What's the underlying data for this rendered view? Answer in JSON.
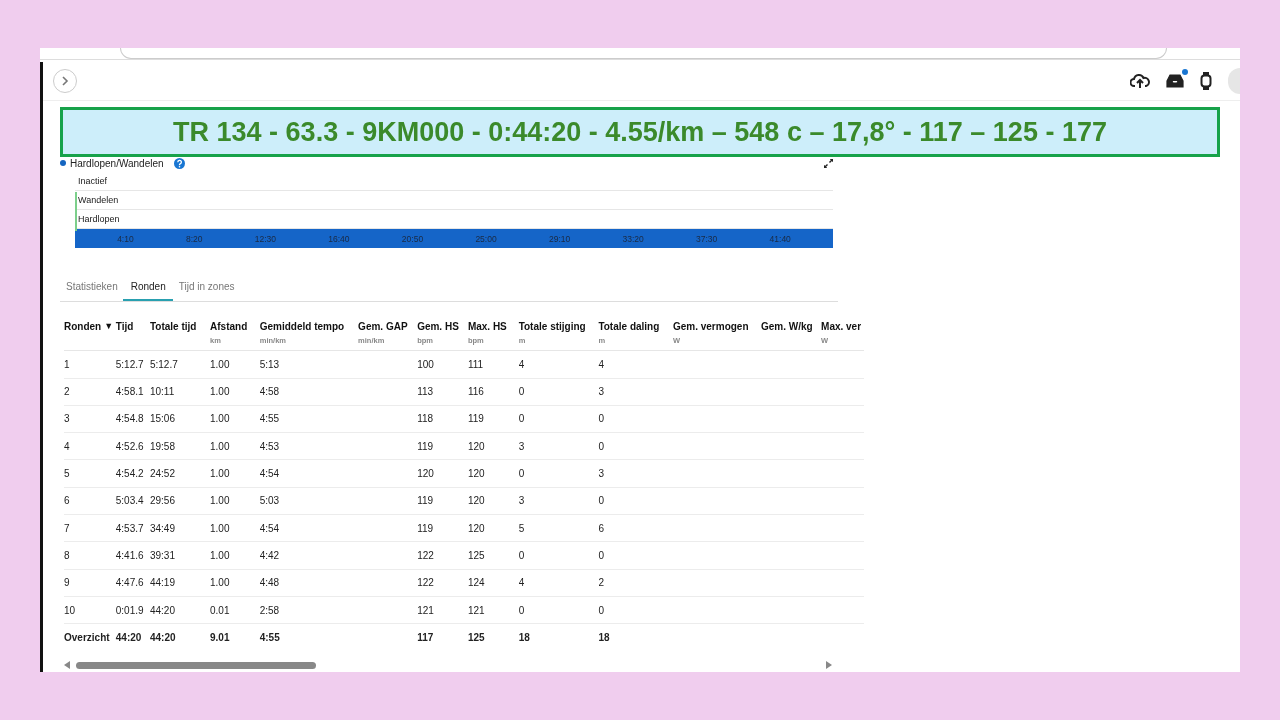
{
  "header": {
    "has_notification": true
  },
  "banner": {
    "text": "TR 134 - 63.3 - 9KM000 - 0:44:20 - 4.55/km – 548 c – 17,8° - 117 – 125 - 177"
  },
  "activity_chart": {
    "legend": "Hardlopen/Wandelen",
    "lanes": [
      "Inactief",
      "Wandelen",
      "Hardlopen"
    ],
    "ticks": [
      "4:10",
      "8:20",
      "12:30",
      "16:40",
      "20:50",
      "25:00",
      "29:10",
      "33:20",
      "37:30",
      "41:40"
    ]
  },
  "tabs": [
    {
      "label": "Statistieken",
      "selected": false
    },
    {
      "label": "Ronden",
      "selected": true
    },
    {
      "label": "Tijd in zones",
      "selected": false
    }
  ],
  "laps_table": {
    "columns": [
      {
        "label": "Ronden",
        "sort_indicator": "▼"
      },
      {
        "label": "Tijd"
      },
      {
        "label": "Totale tijd"
      },
      {
        "label": "Afstand",
        "unit": "km"
      },
      {
        "label": "Gemiddeld tempo",
        "unit": "min/km"
      },
      {
        "label": "Gem. GAP",
        "unit": "min/km"
      },
      {
        "label": "Gem. HS",
        "unit": "bpm"
      },
      {
        "label": "Max. HS",
        "unit": "bpm"
      },
      {
        "label": "Totale stijging",
        "unit": "m"
      },
      {
        "label": "Totale daling",
        "unit": "m"
      },
      {
        "label": "Gem. vermogen",
        "unit": "W"
      },
      {
        "label": "Gem. W/kg"
      },
      {
        "label": "Max. ver",
        "unit": "W"
      }
    ],
    "rows": [
      [
        "1",
        "5:12.7",
        "5:12.7",
        "1.00",
        "5:13",
        "",
        "100",
        "111",
        "4",
        "4"
      ],
      [
        "2",
        "4:58.1",
        "10:11",
        "1.00",
        "4:58",
        "",
        "113",
        "116",
        "0",
        "3"
      ],
      [
        "3",
        "4:54.8",
        "15:06",
        "1.00",
        "4:55",
        "",
        "118",
        "119",
        "0",
        "0"
      ],
      [
        "4",
        "4:52.6",
        "19:58",
        "1.00",
        "4:53",
        "",
        "119",
        "120",
        "3",
        "0"
      ],
      [
        "5",
        "4:54.2",
        "24:52",
        "1.00",
        "4:54",
        "",
        "120",
        "120",
        "0",
        "3"
      ],
      [
        "6",
        "5:03.4",
        "29:56",
        "1.00",
        "5:03",
        "",
        "119",
        "120",
        "3",
        "0"
      ],
      [
        "7",
        "4:53.7",
        "34:49",
        "1.00",
        "4:54",
        "",
        "119",
        "120",
        "5",
        "6"
      ],
      [
        "8",
        "4:41.6",
        "39:31",
        "1.00",
        "4:42",
        "",
        "122",
        "125",
        "0",
        "0"
      ],
      [
        "9",
        "4:47.6",
        "44:19",
        "1.00",
        "4:48",
        "",
        "122",
        "124",
        "4",
        "2"
      ],
      [
        "10",
        "0:01.9",
        "44:20",
        "0.01",
        "2:58",
        "",
        "121",
        "121",
        "0",
        "0"
      ],
      [
        "Overzicht",
        "44:20",
        "44:20",
        "9.01",
        "4:55",
        "",
        "117",
        "125",
        "18",
        "18"
      ]
    ],
    "last_row_is_total": true
  }
}
